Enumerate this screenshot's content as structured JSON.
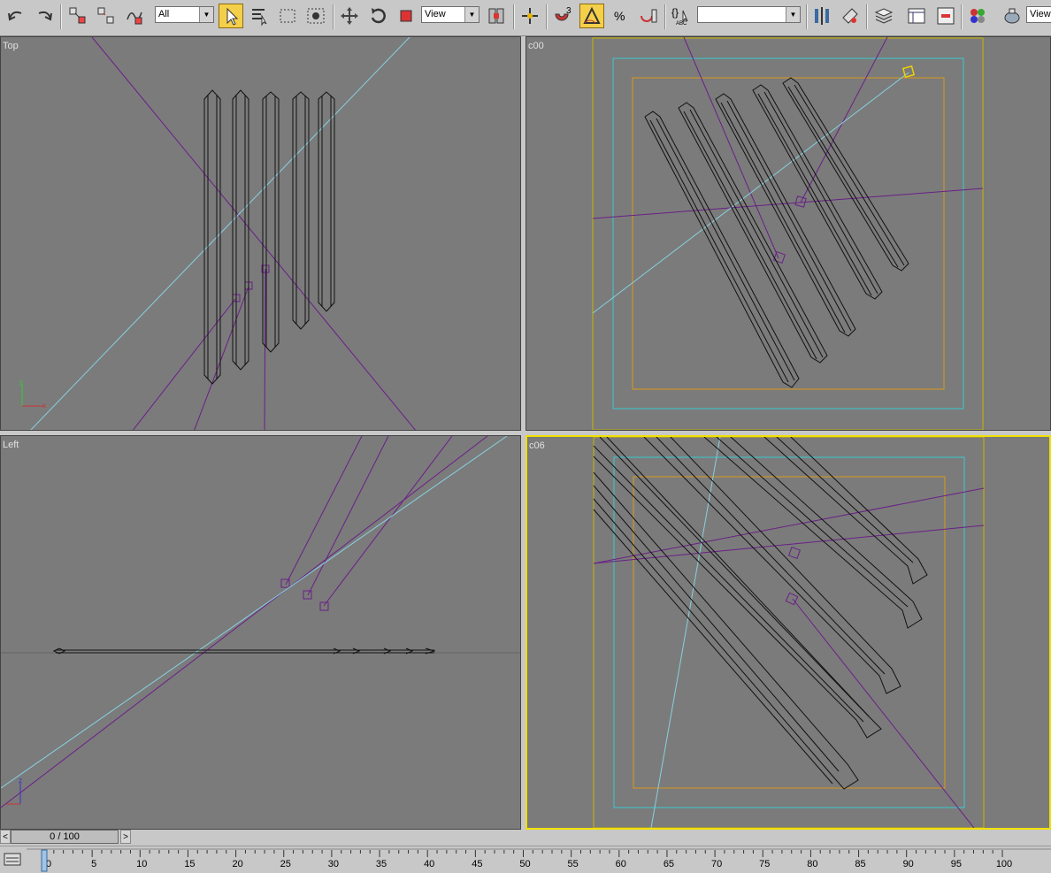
{
  "toolbar": {
    "selection_filter": "All",
    "coord_system": "View",
    "named_selection": "",
    "trailing_view": "View",
    "active_tool": "select-object"
  },
  "viewports": {
    "top_left": {
      "label": "Top"
    },
    "top_right": {
      "label": "c00"
    },
    "bottom_left": {
      "label": "Left"
    },
    "bottom_right": {
      "label": "c06",
      "selected": true
    }
  },
  "time_slider": {
    "prev": "<",
    "next": ">",
    "current_frame": 0,
    "total_frames": 100,
    "display": "0 / 100"
  },
  "timeline": {
    "tick_labels": [
      "0",
      "5",
      "10",
      "15",
      "20",
      "25",
      "30",
      "35",
      "40",
      "45",
      "50",
      "55",
      "60",
      "65",
      "70",
      "75",
      "80",
      "85",
      "90",
      "95",
      "100"
    ]
  },
  "colors": {
    "viewport_bg": "#7b7b7b",
    "active_tool_bg": "#f4cf4a",
    "selected_viewport_border": "#f0e000",
    "camera_line": "#6a1f87",
    "target_line": "#88d0e0",
    "safe_frame_outer": "#c8b400",
    "safe_frame_mid": "#38c8d0",
    "safe_frame_inner": "#d89a18"
  }
}
